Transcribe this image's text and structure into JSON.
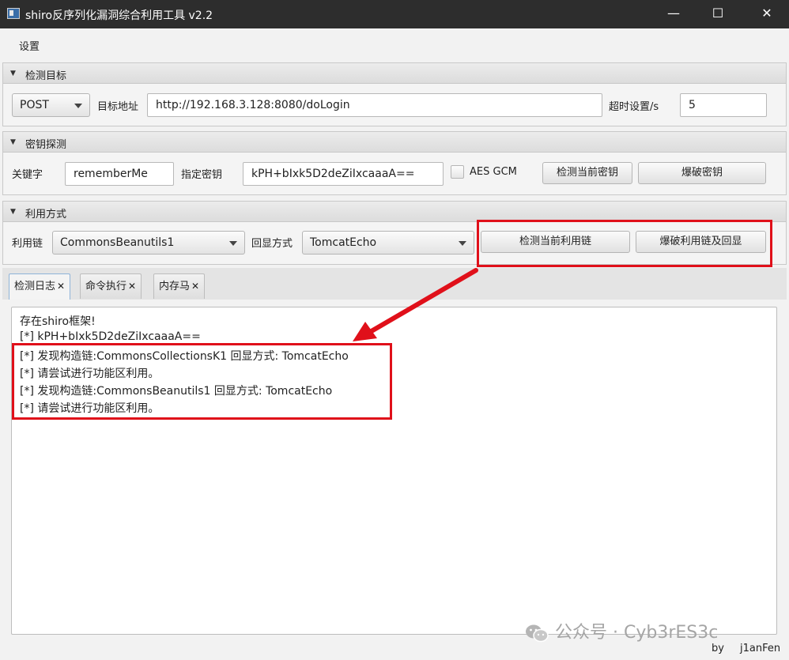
{
  "window": {
    "title": "shiro反序列化漏洞综合利用工具 v2.2",
    "min_glyph": "—",
    "max_glyph": "☐",
    "close_glyph": "✕"
  },
  "menu": {
    "settings": "设置"
  },
  "target_panel": {
    "title": "检测目标",
    "method": "POST",
    "url_label": "目标地址",
    "url_value": "http://192.168.3.128:8080/doLogin",
    "timeout_label": "超时设置/s",
    "timeout_value": "5"
  },
  "key_panel": {
    "title": "密钥探测",
    "keyword_label": "关键字",
    "keyword_value": "rememberMe",
    "key_label": "指定密钥",
    "key_value": "kPH+bIxk5D2deZiIxcaaaA==",
    "aes_gcm_label": "AES GCM",
    "aes_gcm_checked": false,
    "check_key_button": "检测当前密钥",
    "brute_key_button": "爆破密钥"
  },
  "exploit_panel": {
    "title": "利用方式",
    "chain_label": "利用链",
    "chain_value": "CommonsBeanutils1",
    "echo_label": "回显方式",
    "echo_value": "TomcatEcho",
    "check_chain_button": "检测当前利用链",
    "brute_chain_button": "爆破利用链及回显"
  },
  "tabs": [
    {
      "label": "检测日志",
      "close": "✕",
      "active": true
    },
    {
      "label": "命令执行",
      "close": "✕",
      "active": false
    },
    {
      "label": "内存马",
      "close": "✕",
      "active": false
    }
  ],
  "log_lines": [
    "存在shiro框架!",
    "[*] kPH+bIxk5D2deZiIxcaaaA==",
    "[*] 发现构造链:CommonsCollectionsK1  回显方式: TomcatEcho",
    "[*] 请尝试进行功能区利用。",
    "[*] 发现构造链:CommonsBeanutils1  回显方式: TomcatEcho",
    "[*] 请尝试进行功能区利用。"
  ],
  "footer": {
    "by": "by",
    "author": "j1anFen"
  },
  "watermark": {
    "text": "公众号 · Cyb3rES3c"
  },
  "colors": {
    "highlight": "#e0101a",
    "titlebar": "#2d2d2d"
  }
}
